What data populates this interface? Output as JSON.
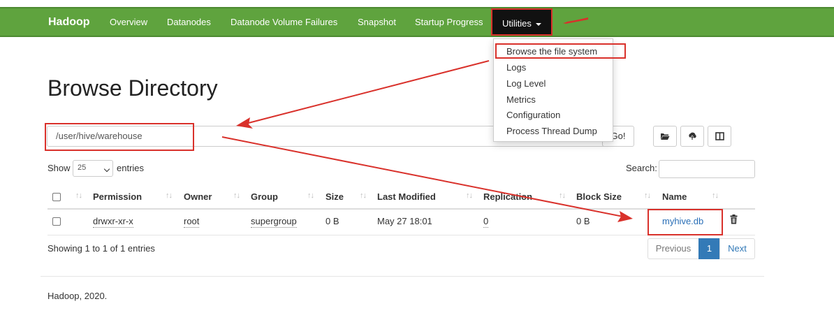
{
  "nav": {
    "brand": "Hadoop",
    "items": [
      "Overview",
      "Datanodes",
      "Datanode Volume Failures",
      "Snapshot",
      "Startup Progress"
    ],
    "utilities": "Utilities"
  },
  "dropdown": {
    "items": [
      "Browse the file system",
      "Logs",
      "Log Level",
      "Metrics",
      "Configuration",
      "Process Thread Dump"
    ]
  },
  "page": {
    "title": "Browse Directory"
  },
  "path_bar": {
    "value": "/user/hive/warehouse",
    "go_label": "Go!",
    "icons": [
      "folder-open-icon",
      "upload-icon",
      "columns-icon"
    ]
  },
  "list_controls": {
    "show_label": "Show",
    "entries_value": "25",
    "entries_label": "entries",
    "search_label": "Search:"
  },
  "table": {
    "columns": [
      "Permission",
      "Owner",
      "Group",
      "Size",
      "Last Modified",
      "Replication",
      "Block Size",
      "Name"
    ],
    "rows": [
      {
        "permission": "drwxr-xr-x",
        "owner": "root",
        "group": "supergroup",
        "size": "0 B",
        "last_modified": "May 27 18:01",
        "replication": "0",
        "block_size": "0 B",
        "name": "myhive.db"
      }
    ]
  },
  "pagination": {
    "summary": "Showing 1 to 1 of 1 entries",
    "previous": "Previous",
    "current": "1",
    "next": "Next"
  },
  "footer": {
    "text": "Hadoop, 2020."
  },
  "colors": {
    "navbar": "#5fa33e",
    "utilities_bg": "#111111",
    "annotation_red": "#d9312b",
    "link_blue": "#2a6fb7",
    "pager_active": "#337ab7"
  }
}
